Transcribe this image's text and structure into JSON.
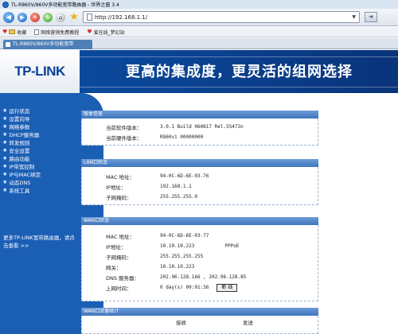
{
  "browser": {
    "window_title": "TL-R860V/860V多功能宽带路由器 - 世界之窗 3.4",
    "address": "http://192.168.1.1/",
    "tab_title": "TL-R860V/860V多功能宽带",
    "bookmarks": [
      "收藏",
      "网络营销免费教程",
      "爱在线_梦幻站"
    ]
  },
  "page": {
    "logo": "TP-LINK",
    "slogan": "更高的集成度，更灵活的组网选择",
    "menu": [
      "运行状态",
      "设置向导",
      "网络参数",
      "DHCP服务器",
      "转发规则",
      "安全设置",
      "路由功能",
      "IP带宽控制",
      "IP与MAC绑定",
      "动态DNS",
      "系统工具"
    ],
    "more_link": "更多TP-LINK宽带路由器，请点击查看 >>",
    "version": {
      "header": "版本信息",
      "rows": [
        {
          "label": "当前软件版本：",
          "value": "3.0.1 Build 060817 Rel.55473n"
        },
        {
          "label": "当前硬件版本：",
          "value": "R860v1 00000000"
        }
      ]
    },
    "lan": {
      "header": "LAN口状态",
      "rows": [
        {
          "label": "MAC 地址：",
          "value": "94-0C-6D-6E-03-76"
        },
        {
          "label": "IP地址：",
          "value": "192.168.1.1"
        },
        {
          "label": "子网掩码：",
          "value": "255.255.255.0"
        }
      ]
    },
    "wan": {
      "header": "WAN口状态",
      "rows": [
        {
          "label": "MAC 地址：",
          "value": "94-0C-6D-6E-03-77",
          "extra": ""
        },
        {
          "label": "IP地址：",
          "value": "10.10.10.223",
          "extra": "PPPoE"
        },
        {
          "label": "子网掩码：",
          "value": "255.255.255.255",
          "extra": ""
        },
        {
          "label": "网关：",
          "value": "10.10.10.223",
          "extra": ""
        },
        {
          "label": "DNS 服务器：",
          "value": "202.96.128.166 , 202.96.128.85",
          "extra": ""
        },
        {
          "label": "上网时间：",
          "value": "0 day(s) 00:01:36",
          "extra": ""
        }
      ],
      "disconnect_label": "断 线"
    },
    "stats": {
      "header": "WAN口流量统计",
      "col_recv": "接收",
      "col_send": "发送"
    }
  },
  "colors": {
    "banner": "#0a4fa6",
    "sidebar": "#1b5fb5",
    "section_header": "#3f75be"
  }
}
